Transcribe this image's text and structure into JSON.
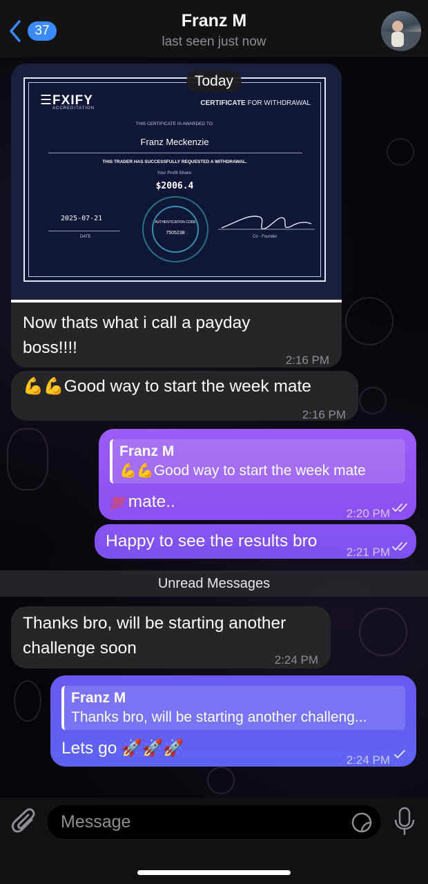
{
  "header": {
    "back_count": "37",
    "title": "Franz M",
    "subtitle": "last seen just now"
  },
  "date_divider": "Today",
  "certificate": {
    "logo": "FXIFY",
    "logo_sub": "ACCREDITATION",
    "heading_bold": "CERTIFICATE",
    "heading_rest": " FOR WITHDRAWAL",
    "awarded_to": "THIS CERTIFICATE IS AWARDED TO:",
    "name": "Franz Meckenzie",
    "statement": "THIS TRADER HAS SUCCESSFULLY REQUESTED A WITHDRAWAL.",
    "profit_label": "Your Profit Share:",
    "amount": "$2006.4",
    "date": "2025-07-21",
    "date_label": "DATE",
    "seal_label": "AUTHENTICATION CODE",
    "seal_code": "7505238",
    "signer_label": "Co - Founder"
  },
  "messages": [
    {
      "text": "Now thats what i call a payday boss!!!!",
      "time": "2:16 PM"
    },
    {
      "text": "Good way to start the week mate",
      "time": "2:16 PM"
    },
    {
      "reply_name": "Franz M",
      "reply_text": "Good way to start the week mate",
      "text": "mate..",
      "time": "2:20 PM"
    },
    {
      "text": "Happy to see the results bro",
      "time": "2:21 PM"
    },
    {
      "text": "Thanks bro, will be starting another challenge soon",
      "time": "2:24 PM"
    },
    {
      "reply_name": "Franz M",
      "reply_text": "Thanks bro, will be starting another challeng...",
      "text": "Lets go",
      "time": "2:24 PM"
    }
  ],
  "unread_label": "Unread Messages",
  "composer": {
    "placeholder": "Message"
  },
  "colors": {
    "accent": "#3b8aff",
    "outgoing_purple": "#8a4ff0",
    "outgoing_blue": "#5d63f2",
    "incoming": "#262628"
  }
}
